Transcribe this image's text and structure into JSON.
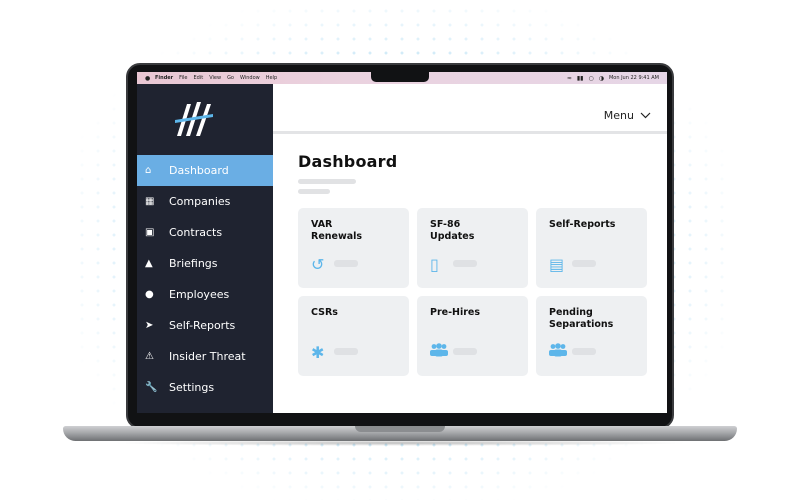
{
  "menubar": {
    "apple": "",
    "items": [
      "Finder",
      "File",
      "Edit",
      "View",
      "Go",
      "Window",
      "Help"
    ],
    "datetime": "Mon Jun 22  9:41 AM"
  },
  "sidebar": {
    "items": [
      {
        "label": "Dashboard",
        "icon": "home-icon"
      },
      {
        "label": "Companies",
        "icon": "building-icon"
      },
      {
        "label": "Contracts",
        "icon": "document-icon"
      },
      {
        "label": "Briefings",
        "icon": "folder-icon"
      },
      {
        "label": "Employees",
        "icon": "user-icon"
      },
      {
        "label": "Self-Reports",
        "icon": "send-icon"
      },
      {
        "label": "Insider Threat",
        "icon": "warning-icon"
      },
      {
        "label": "Settings",
        "icon": "wrench-icon"
      }
    ],
    "active": "Dashboard"
  },
  "header": {
    "menu_label": "Menu"
  },
  "main": {
    "title": "Dashboard",
    "cards": [
      {
        "line1": "VAR",
        "line2": "Renewals",
        "icon": "history-icon"
      },
      {
        "line1": "SF-86",
        "line2": "Updates",
        "icon": "book-icon"
      },
      {
        "line1": "Self-Reports",
        "line2": "",
        "icon": "id-card-icon"
      },
      {
        "line1": "CSRs",
        "line2": "",
        "icon": "asterisk-icon"
      },
      {
        "line1": "Pre-Hires",
        "line2": "",
        "icon": "users-icon"
      },
      {
        "line1": "Pending",
        "line2": "Separations",
        "icon": "users-icon"
      }
    ]
  },
  "colors": {
    "sidebar_bg": "#1f2330",
    "active_bg": "#6aaee4",
    "accent": "#5db6ea",
    "card_bg": "#eef0f2"
  }
}
